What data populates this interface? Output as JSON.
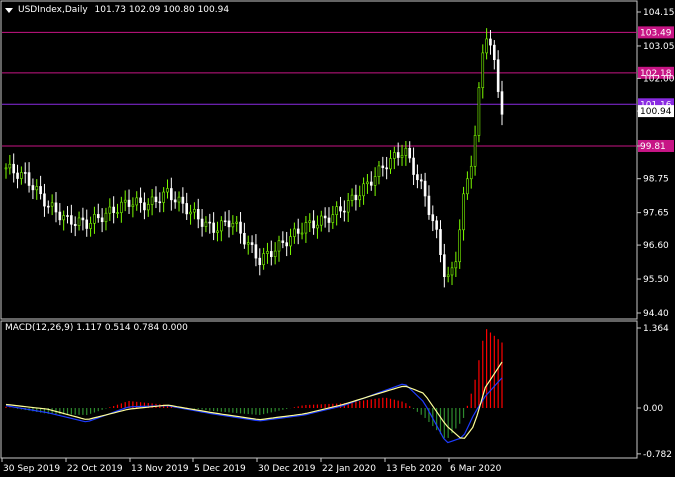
{
  "main_header": {
    "symbol_label": "USDIndex,Daily",
    "ohlc": "101.73 102.09 100.80 100.94"
  },
  "macd_header": {
    "label": "MACD(12,26,9) 1.117 0.514 0.784 0.000"
  },
  "colors": {
    "background": "#000000",
    "frame": "#c8c8c8",
    "bull": "#7CFC00",
    "bear": "#ffffff",
    "level_line": "#c71585",
    "level_line_current": "#8a2be2",
    "hist_pos": "#ff0000",
    "hist_neg": "#2e8b2e",
    "macd_line": "#1e3cff",
    "signal_line": "#ffff99"
  },
  "price_axis": {
    "ticks": [
      "104.15",
      "103.05",
      "102.00",
      "100.94",
      "99.81",
      "98.75",
      "97.65",
      "96.60",
      "95.50",
      "94.40"
    ]
  },
  "levels": [
    {
      "value": 103.49,
      "label": "103.49",
      "kind": "level"
    },
    {
      "value": 102.18,
      "label": "102.18",
      "kind": "level"
    },
    {
      "value": 101.16,
      "label": "101.16",
      "kind": "current"
    },
    {
      "value": 99.81,
      "label": "99.81",
      "kind": "level"
    }
  ],
  "current_price_label": "100.94",
  "macd_axis": {
    "ticks": [
      "1.364",
      "0.00",
      "-0.782"
    ]
  },
  "time_axis": {
    "labels": [
      "30 Sep 2019",
      "22 Oct 2019",
      "13 Nov 2019",
      "5 Dec 2019",
      "30 Dec 2019",
      "22 Jan 2020",
      "13 Feb 2020",
      "6 Mar 2020"
    ]
  },
  "chart_data": [
    {
      "type": "candlestick",
      "title": "USDIndex,Daily",
      "ylim": [
        94.4,
        104.15
      ],
      "close_path": [
        {
          "x": "30 Sep 2019",
          "y": 99.1
        },
        {
          "x": "7 Oct 2019",
          "y": 98.8
        },
        {
          "x": "15 Oct 2019",
          "y": 97.9
        },
        {
          "x": "22 Oct 2019",
          "y": 97.4
        },
        {
          "x": "29 Oct 2019",
          "y": 97.3
        },
        {
          "x": "5 Nov 2019",
          "y": 97.6
        },
        {
          "x": "13 Nov 2019",
          "y": 98.0
        },
        {
          "x": "20 Nov 2019",
          "y": 97.9
        },
        {
          "x": "27 Nov 2019",
          "y": 98.3
        },
        {
          "x": "5 Dec 2019",
          "y": 97.7
        },
        {
          "x": "13 Dec 2019",
          "y": 97.1
        },
        {
          "x": "20 Dec 2019",
          "y": 97.4
        },
        {
          "x": "30 Dec 2019",
          "y": 96.1
        },
        {
          "x": "8 Jan 2020",
          "y": 96.7
        },
        {
          "x": "15 Jan 2020",
          "y": 97.2
        },
        {
          "x": "22 Jan 2020",
          "y": 97.4
        },
        {
          "x": "29 Jan 2020",
          "y": 97.8
        },
        {
          "x": "5 Feb 2020",
          "y": 98.4
        },
        {
          "x": "13 Feb 2020",
          "y": 99.2
        },
        {
          "x": "20 Feb 2020",
          "y": 99.7
        },
        {
          "x": "27 Feb 2020",
          "y": 98.3
        },
        {
          "x": "3 Mar 2020",
          "y": 96.8
        },
        {
          "x": "6 Mar 2020",
          "y": 95.4
        },
        {
          "x": "9 Mar 2020",
          "y": 95.9
        },
        {
          "x": "12 Mar 2020",
          "y": 98.0
        },
        {
          "x": "16 Mar 2020",
          "y": 99.8
        },
        {
          "x": "19 Mar 2020",
          "y": 102.8
        },
        {
          "x": "20 Mar 2020",
          "y": 103.6
        },
        {
          "x": "23 Mar 2020",
          "y": 102.6
        },
        {
          "x": "26 Mar 2020",
          "y": 100.94
        }
      ]
    },
    {
      "type": "bar",
      "title": "MACD(12,26,9)",
      "ylim": [
        -0.782,
        1.364
      ],
      "histogram_path": [
        {
          "x": "30 Sep 2019",
          "y": 0.02
        },
        {
          "x": "15 Oct 2019",
          "y": -0.1
        },
        {
          "x": "29 Oct 2019",
          "y": -0.12
        },
        {
          "x": "13 Nov 2019",
          "y": 0.12
        },
        {
          "x": "27 Nov 2019",
          "y": 0.05
        },
        {
          "x": "13 Dec 2019",
          "y": -0.05
        },
        {
          "x": "30 Dec 2019",
          "y": -0.12
        },
        {
          "x": "15 Jan 2020",
          "y": 0.05
        },
        {
          "x": "29 Jan 2020",
          "y": 0.08
        },
        {
          "x": "13 Feb 2020",
          "y": 0.18
        },
        {
          "x": "20 Feb 2020",
          "y": 0.1
        },
        {
          "x": "27 Feb 2020",
          "y": -0.15
        },
        {
          "x": "6 Mar 2020",
          "y": -0.55
        },
        {
          "x": "12 Mar 2020",
          "y": -0.2
        },
        {
          "x": "16 Mar 2020",
          "y": 0.4
        },
        {
          "x": "20 Mar 2020",
          "y": 1.364
        },
        {
          "x": "26 Mar 2020",
          "y": 1.117
        }
      ],
      "signal_path": [
        {
          "x": "30 Sep 2019",
          "y": 0.06
        },
        {
          "x": "15 Oct 2019",
          "y": -0.02
        },
        {
          "x": "29 Oct 2019",
          "y": -0.2
        },
        {
          "x": "13 Nov 2019",
          "y": -0.02
        },
        {
          "x": "27 Nov 2019",
          "y": 0.05
        },
        {
          "x": "13 Dec 2019",
          "y": -0.08
        },
        {
          "x": "30 Dec 2019",
          "y": -0.2
        },
        {
          "x": "15 Jan 2020",
          "y": -0.1
        },
        {
          "x": "29 Jan 2020",
          "y": 0.06
        },
        {
          "x": "13 Feb 2020",
          "y": 0.28
        },
        {
          "x": "20 Feb 2020",
          "y": 0.38
        },
        {
          "x": "27 Feb 2020",
          "y": 0.25
        },
        {
          "x": "6 Mar 2020",
          "y": -0.3
        },
        {
          "x": "12 Mar 2020",
          "y": -0.55
        },
        {
          "x": "16 Mar 2020",
          "y": -0.3
        },
        {
          "x": "20 Mar 2020",
          "y": 0.35
        },
        {
          "x": "26 Mar 2020",
          "y": 0.784
        }
      ],
      "macd_path": [
        {
          "x": "30 Sep 2019",
          "y": 0.04
        },
        {
          "x": "15 Oct 2019",
          "y": -0.08
        },
        {
          "x": "29 Oct 2019",
          "y": -0.24
        },
        {
          "x": "13 Nov 2019",
          "y": 0.02
        },
        {
          "x": "27 Nov 2019",
          "y": 0.04
        },
        {
          "x": "13 Dec 2019",
          "y": -0.1
        },
        {
          "x": "30 Dec 2019",
          "y": -0.22
        },
        {
          "x": "15 Jan 2020",
          "y": -0.12
        },
        {
          "x": "29 Jan 2020",
          "y": 0.04
        },
        {
          "x": "13 Feb 2020",
          "y": 0.3
        },
        {
          "x": "20 Feb 2020",
          "y": 0.42
        },
        {
          "x": "27 Feb 2020",
          "y": 0.1
        },
        {
          "x": "6 Mar 2020",
          "y": -0.6
        },
        {
          "x": "12 Mar 2020",
          "y": -0.5
        },
        {
          "x": "16 Mar 2020",
          "y": -0.1
        },
        {
          "x": "20 Mar 2020",
          "y": 0.2
        },
        {
          "x": "26 Mar 2020",
          "y": 0.514
        }
      ]
    }
  ]
}
